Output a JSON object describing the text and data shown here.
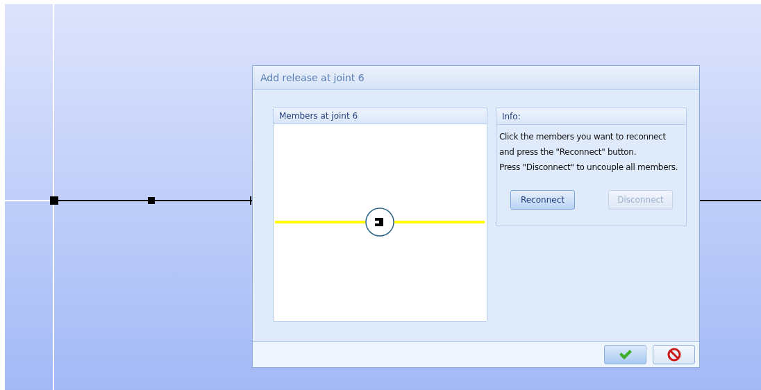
{
  "dialog": {
    "title": "Add release at joint 6",
    "members_panel": {
      "title": "Members at joint 6"
    },
    "info_panel": {
      "title": "Info:",
      "lines": [
        "Click the members you want to reconnect",
        "and press the \"Reconnect\" button.",
        "Press \"Disconnect\" to uncouple all members."
      ],
      "buttons": [
        {
          "label": "Reconnect",
          "disabled": false
        },
        {
          "label": "Disconnect",
          "disabled": true
        }
      ]
    },
    "footer_buttons": [
      {
        "kind": "ok"
      },
      {
        "kind": "cancel"
      }
    ]
  }
}
